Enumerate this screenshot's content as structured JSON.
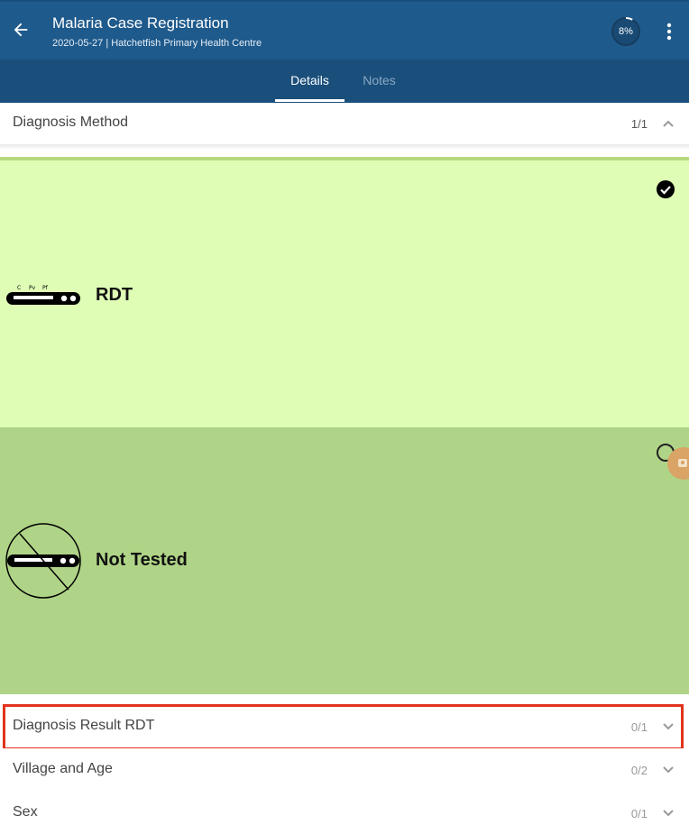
{
  "app_bar": {
    "title": "Malaria Case Registration",
    "subtitle": "2020-05-27 | Hatchetfish Primary Health Centre",
    "progress_label": "8%",
    "progress_value": 0.08,
    "back_icon": "arrow-back-icon",
    "more_icon": "more-vertical-icon",
    "background_color": "#1f5a8c"
  },
  "tabs": [
    {
      "label": "Details",
      "active": true
    },
    {
      "label": "Notes",
      "active": false
    }
  ],
  "sections": {
    "diagnosis_method": {
      "title": "Diagnosis Method",
      "count": "1/1",
      "expanded": true
    },
    "diagnosis_result_rdt": {
      "title": "Diagnosis Result RDT",
      "count": "0/1",
      "expanded": false
    },
    "village_and_age": {
      "title": "Village and Age",
      "count": "0/2",
      "expanded": false
    },
    "sex": {
      "title": "Sex",
      "count": "0/1",
      "expanded": false
    }
  },
  "options": [
    {
      "label": "RDT",
      "selected": true,
      "icon": "rdt-test-strip-icon",
      "color": "#dffdb5"
    },
    {
      "label": "Not Tested",
      "selected": false,
      "icon": "not-tested-icon",
      "color": "#b0d487"
    }
  ],
  "strip_labels": {
    "c": "C",
    "pv": "Pv",
    "pf": "Pf"
  },
  "colors": {
    "highlight": "#e2331c",
    "fab": "#d9a466"
  }
}
